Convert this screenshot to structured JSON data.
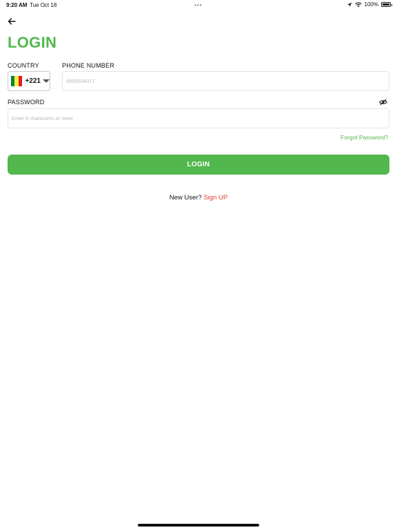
{
  "status_bar": {
    "time": "9:20 AM",
    "date": "Tue Oct 18",
    "dots": "•••",
    "battery_pct": "100%",
    "battery_level": 1.0
  },
  "header": {
    "back_icon": "arrow-left-icon",
    "title": "LOGIN"
  },
  "form": {
    "country_label": "COUNTRY",
    "country_code": "+221",
    "country_flag": "senegal-flag-icon",
    "phone_label": "PHONE NUMBER",
    "phone_placeholder": "6893504317",
    "password_label": "PASSWORD",
    "password_placeholder": "Enter 8 characters or more",
    "toggle_icon": "eye-slash-icon",
    "forgot_label": "Forgot Password?",
    "submit_label": "LOGIN"
  },
  "footer": {
    "new_user_text": "New User?",
    "signup_label": "Sign UP"
  },
  "colors": {
    "accent": "#52b84d",
    "link_red": "#e53935",
    "flag_green": "#00853f",
    "flag_yellow": "#fdef42",
    "flag_red": "#e31b23"
  }
}
